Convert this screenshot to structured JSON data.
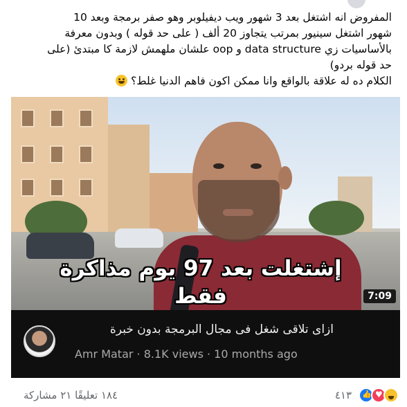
{
  "post": {
    "lines": [
      "المفروض انه اشتغل بعد 3 شهور ويب ديفيلوبر وهو صفر برمجة وبعد 10",
      "شهور اشتغل سينيور بمرتب يتجاوز 20 ألف ( على حد قوله ) وبدون معرفة",
      "بالأساسيات زي data structure و oop علشان ملهمش لازمة كا مبتدئ (على",
      "حد قوله بردو)",
      "الكلام ده له علاقة بالواقع وانا ممكن اكون فاهم الدنيا غلط؟"
    ],
    "emoji_icon": "grinning-face-emoji"
  },
  "video": {
    "overlay_title": "إشتغلت بعد 97 يوم مذاكرة فقط",
    "duration": "7:09",
    "title": "ازاى تلاقى شغل فى مجال البرمجة بدون خبرة",
    "meta": "Amr Matar · 8.1K views · 10 months ago"
  },
  "reactions": {
    "count": "٤١٣",
    "icons": [
      "haha-icon",
      "love-icon",
      "like-icon"
    ],
    "comments": "١٨٤ تعليقًا",
    "shares": "٢١ مشاركة",
    "colors": {
      "like": "#1877f2",
      "love": "#f33e58",
      "haha": "#f7c22c"
    }
  }
}
